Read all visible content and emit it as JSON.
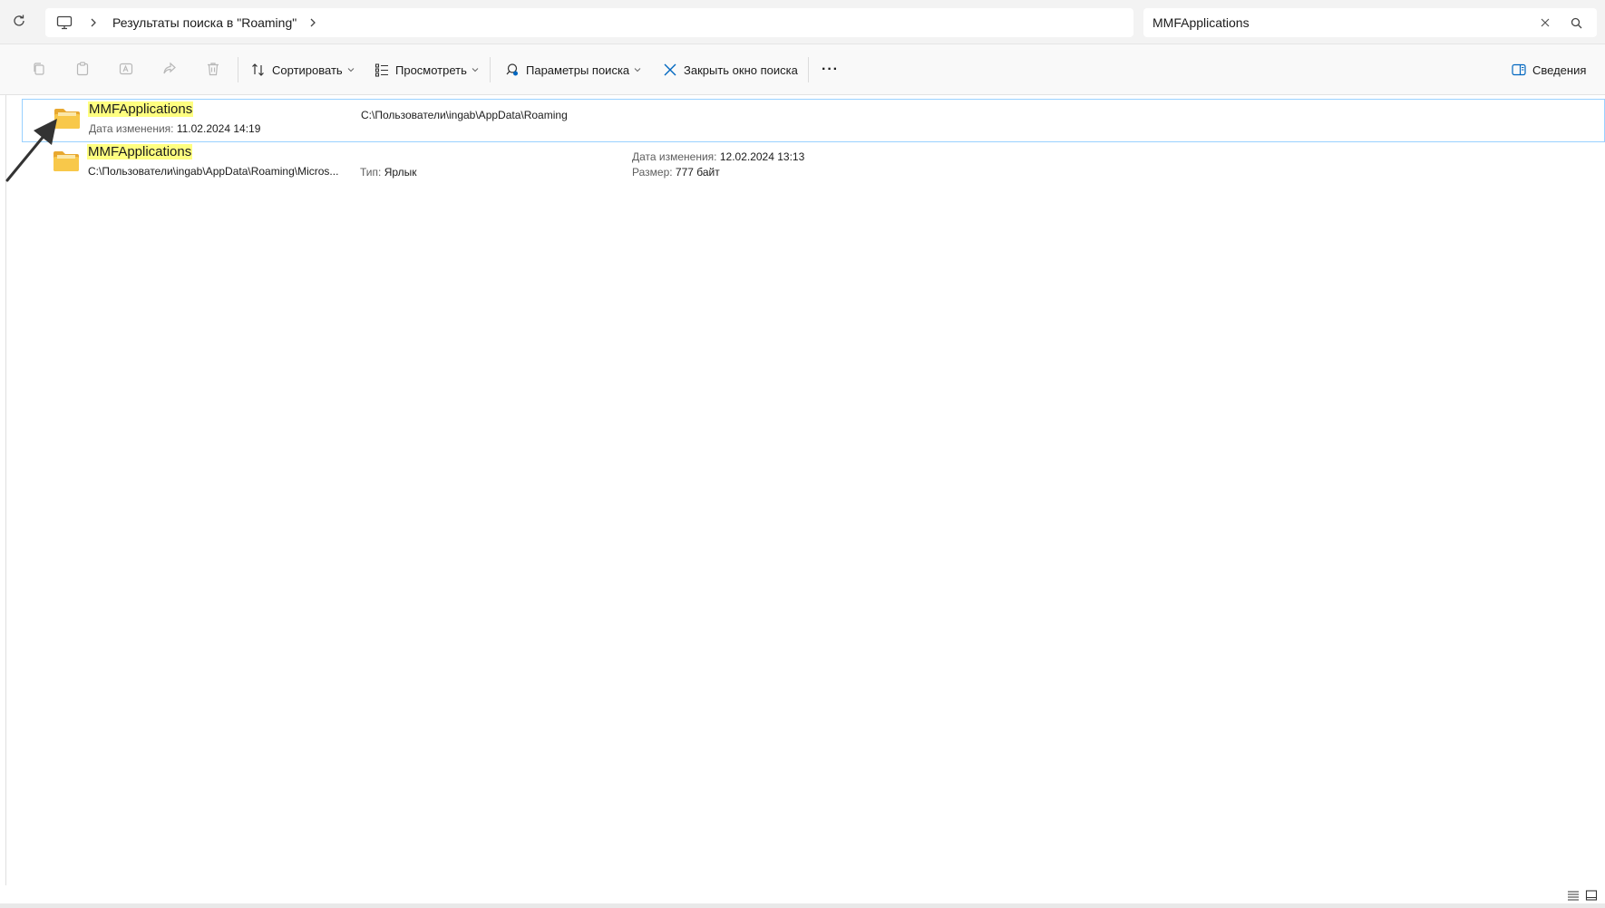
{
  "address": {
    "crumb": "Результаты поиска в \"Roaming\""
  },
  "search": {
    "value": "MMFApplications"
  },
  "toolbar": {
    "sort": "Сортировать",
    "view": "Просмотреть",
    "search_options": "Параметры поиска",
    "close_search": "Закрыть окно поиска",
    "more": "···",
    "details": "Сведения"
  },
  "results": [
    {
      "name": "MMFApplications",
      "modified_label": "Дата изменения:",
      "modified_value": "11.02.2024 14:19",
      "location": "C:\\Пользователи\\ingab\\AppData\\Roaming"
    },
    {
      "name": "MMFApplications",
      "path": "C:\\Пользователи\\ingab\\AppData\\Roaming\\Micros...",
      "type_label": "Тип:",
      "type_value": "Ярлык",
      "modified_label": "Дата изменения:",
      "modified_value": "12.02.2024 13:13",
      "size_label": "Размер:",
      "size_value": "777 байт"
    }
  ],
  "colors": {
    "highlight": "#ffff80",
    "selection_border": "#99d1ff",
    "folder": "#f8c84a",
    "accent": "#0067c0"
  },
  "icons": [
    "refresh-icon",
    "computer-icon",
    "chevron-right-icon",
    "close-icon",
    "search-icon",
    "copy-icon",
    "paste-icon",
    "rename-icon",
    "share-icon",
    "delete-icon",
    "sort-icon",
    "view-icon",
    "search-options-icon",
    "more-icon",
    "details-pane-icon",
    "folder-icon",
    "arrow-annotation",
    "details-view-icon",
    "large-icons-view-icon"
  ]
}
